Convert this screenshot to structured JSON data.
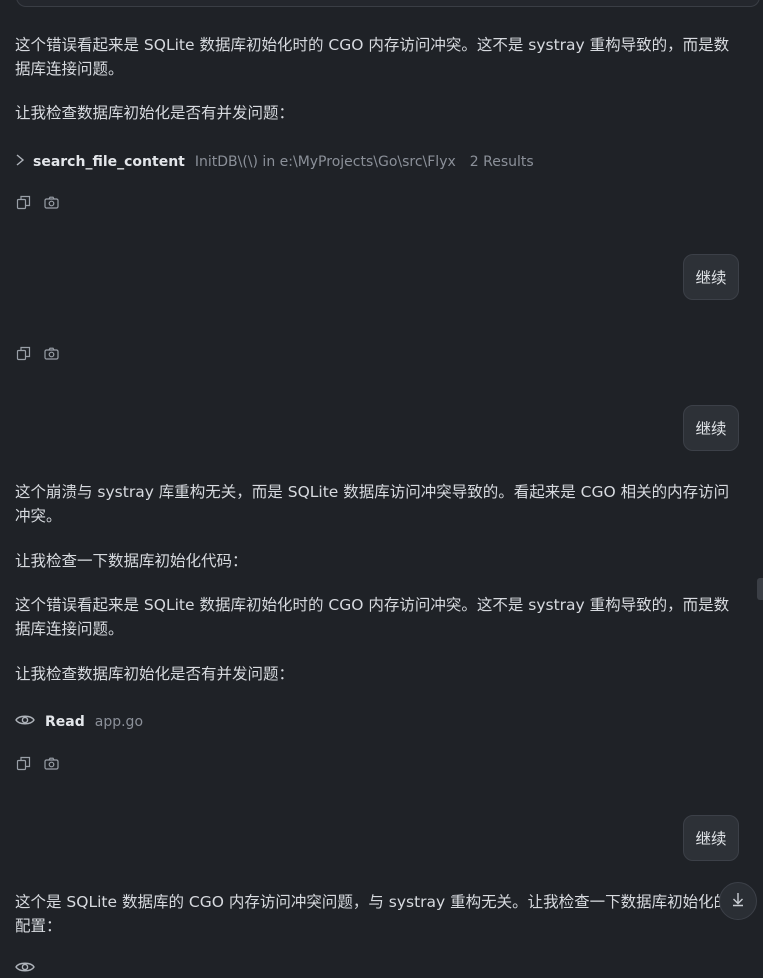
{
  "messages": {
    "p1": "这个错误看起来是 SQLite 数据库初始化时的 CGO 内存访问冲突。这不是 systray 重构导致的，而是数据库连接问题。",
    "p2": "让我检查数据库初始化是否有并发问题：",
    "tool1": {
      "name": "search_file_content",
      "args": "InitDB\\(\\) in e:\\MyProjects\\Go\\src\\Flyx",
      "results": "2 Results"
    },
    "user1": "继续",
    "user2": "继续",
    "p3": "这个崩溃与 systray 库重构无关，而是 SQLite 数据库访问冲突导致的。看起来是 CGO 相关的内存访问冲突。",
    "p4": "让我检查一下数据库初始化代码：",
    "p5": "这个错误看起来是 SQLite 数据库初始化时的 CGO 内存访问冲突。这不是 systray 重构导致的，而是数据库连接问题。",
    "p6": "让我检查数据库初始化是否有并发问题：",
    "tool2": {
      "name": "Read",
      "args": "app.go"
    },
    "user3": "继续",
    "p7": "这个是 SQLite 数据库的 CGO 内存访问冲突问题，与 systray 重构无关。让我检查一下数据库初始化的配置："
  },
  "colors": {
    "background": "#1f2227",
    "text": "#d7dadf",
    "muted": "#8b9099",
    "bubble": "#2d3137"
  }
}
